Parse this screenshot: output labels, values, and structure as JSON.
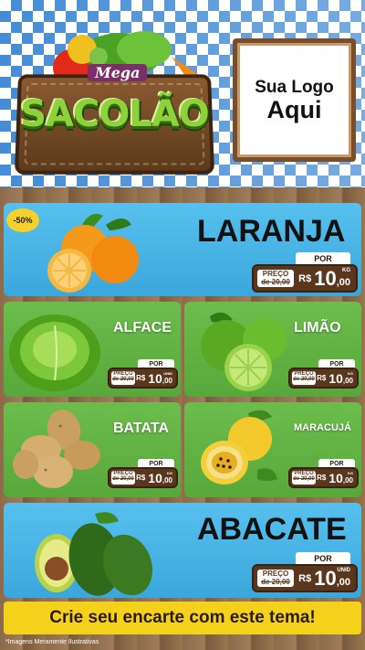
{
  "brand": {
    "top": "Mega",
    "name": "SACOLÃO"
  },
  "logo_box": {
    "line1": "Sua Logo",
    "line2": "Aqui"
  },
  "discount_badge": "-50%",
  "products": [
    {
      "name": "LARANJA",
      "label_por": "POR",
      "label_preco": "PREÇO",
      "old_prefix": "de",
      "old_price": "20,00",
      "currency": "R$",
      "price_int": "10",
      "price_dec": ",00",
      "unit": "KG"
    },
    {
      "name": "ALFACE",
      "label_por": "POR",
      "label_preco": "PREÇO",
      "old_prefix": "de",
      "old_price": "20,00",
      "currency": "R$",
      "price_int": "10",
      "price_dec": ",00",
      "unit": "UNID"
    },
    {
      "name": "LIMÃO",
      "label_por": "POR",
      "label_preco": "PREÇO",
      "old_prefix": "de",
      "old_price": "20,00",
      "currency": "R$",
      "price_int": "10",
      "price_dec": ",00",
      "unit": "KG"
    },
    {
      "name": "BATATA",
      "label_por": "POR",
      "label_preco": "PREÇO",
      "old_prefix": "de",
      "old_price": "20,00",
      "currency": "R$",
      "price_int": "10",
      "price_dec": ",00",
      "unit": "KG"
    },
    {
      "name": "MARACUJÁ",
      "label_por": "POR",
      "label_preco": "PREÇO",
      "old_prefix": "de",
      "old_price": "20,00",
      "currency": "R$",
      "price_int": "10",
      "price_dec": ",00",
      "unit": "KG"
    },
    {
      "name": "ABACATE",
      "label_por": "POR",
      "label_preco": "PREÇO",
      "old_prefix": "de",
      "old_price": "20,00",
      "currency": "R$",
      "price_int": "10",
      "price_dec": ",00",
      "unit": "UNID"
    }
  ],
  "cta": "Crie seu encarte com este tema!",
  "disclaimer": "*Imagens Meramente Ilustrativas"
}
